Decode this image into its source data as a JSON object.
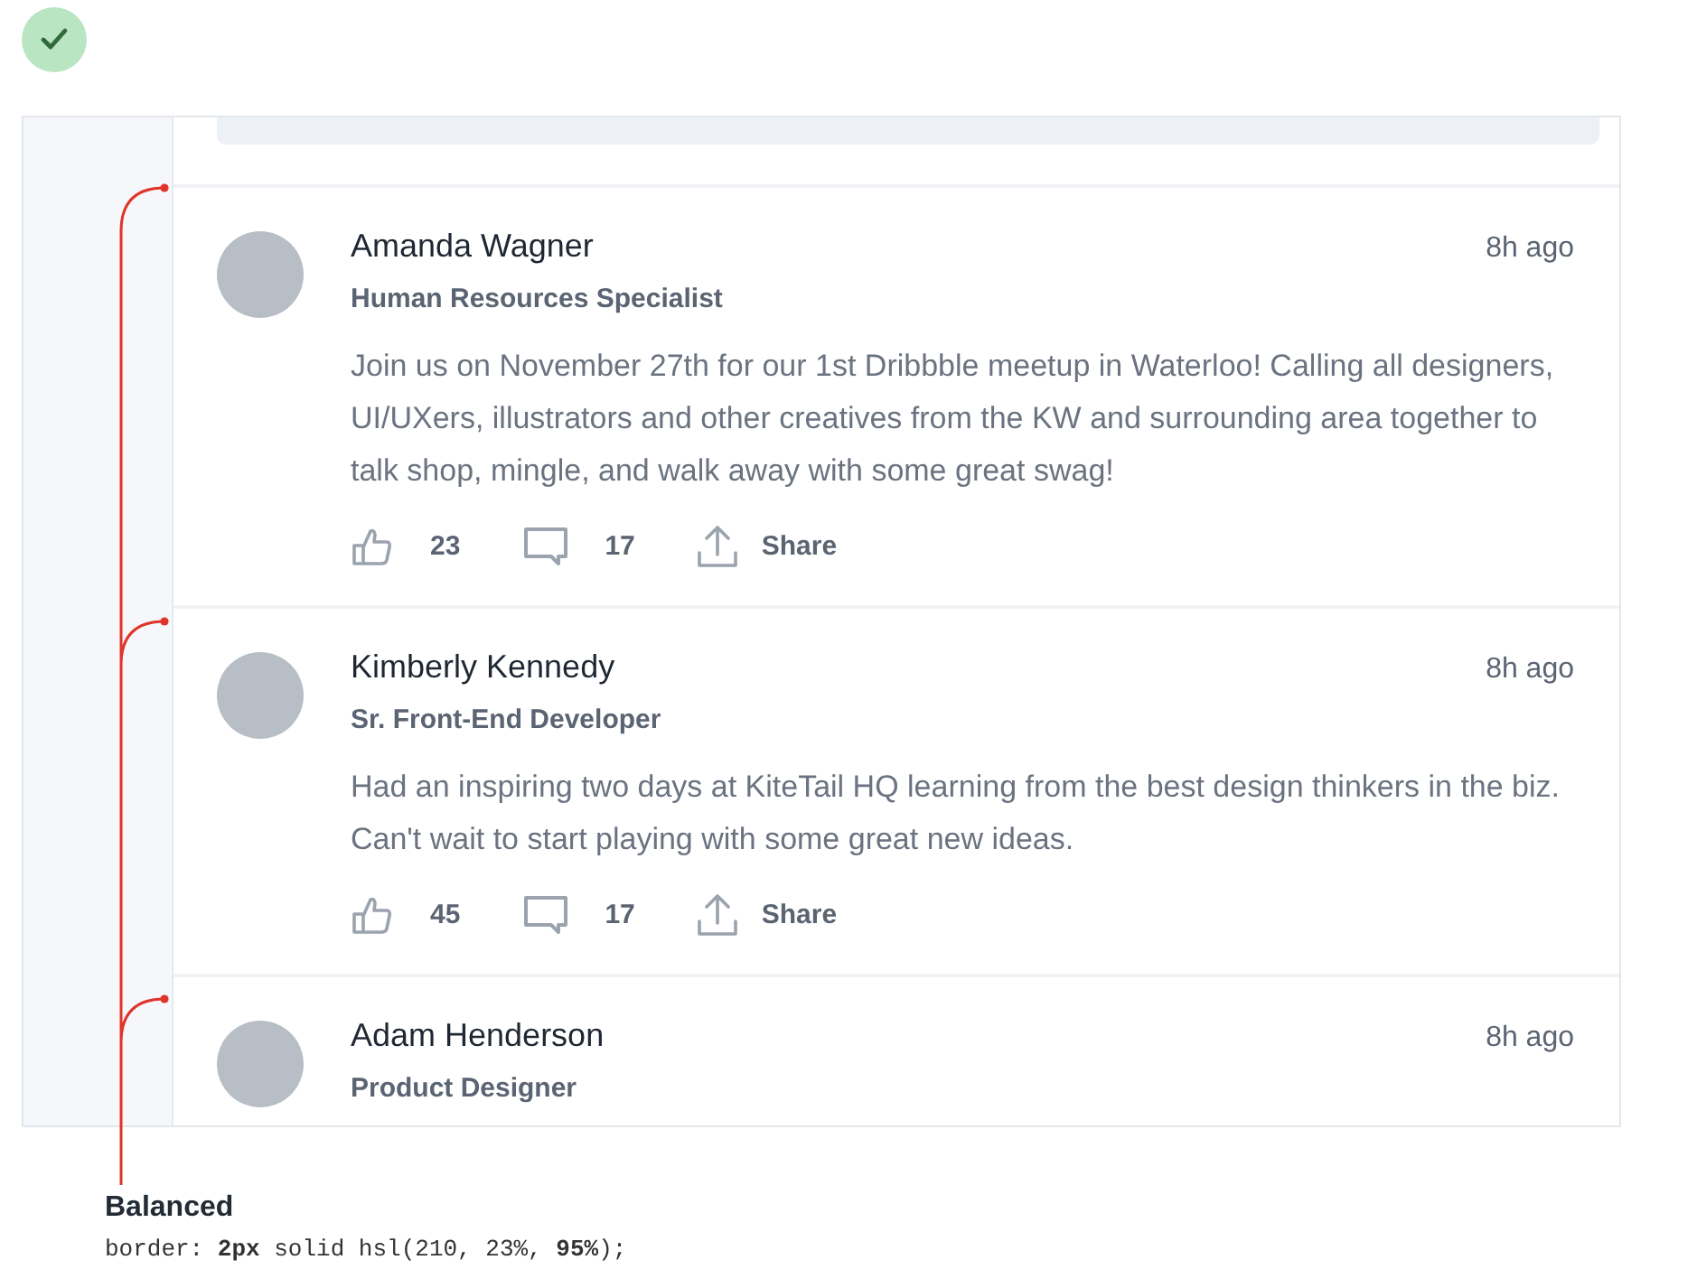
{
  "posts": [
    {
      "author": "Amanda Wagner",
      "role": "Human Resources Specialist",
      "time": "8h ago",
      "body": "Join us on November 27th for our 1st Dribbble meetup in Waterloo! Calling all designers, UI/UXers, illustrators and other creatives from the KW and surrounding area together to talk shop, mingle, and walk away with some great swag!",
      "likes": "23",
      "comments": "17",
      "share": "Share"
    },
    {
      "author": "Kimberly Kennedy",
      "role": "Sr. Front-End Developer",
      "time": "8h ago",
      "body": "Had an inspiring two days at KiteTail HQ learning from the best design thinkers in the biz. Can't wait to start playing with some great new ideas.",
      "likes": "45",
      "comments": "17",
      "share": "Share"
    },
    {
      "author": "Adam Henderson",
      "role": "Product Designer",
      "time": "8h ago"
    }
  ],
  "caption": {
    "title": "Balanced",
    "code": "border: **2px** solid hsl(210, 23%, **95%**);"
  }
}
